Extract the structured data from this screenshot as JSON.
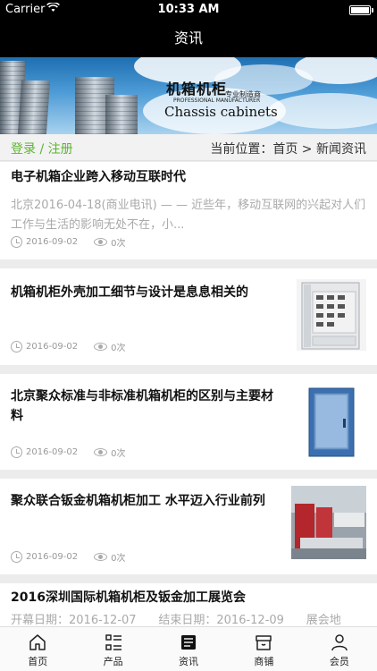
{
  "status_bar": {
    "carrier": "Carrier",
    "time": "10:33 AM"
  },
  "nav": {
    "title": "资讯"
  },
  "banner": {
    "title_cn": "机箱机柜",
    "tagline": "专业制造商",
    "tagline_en": "PROFESSIONAL MANUFACTURER",
    "title_en": "Chassis cabinets"
  },
  "crumb": {
    "login": "登录 / 注册",
    "location": "当前位置：首页 > 新闻资讯"
  },
  "articles": [
    {
      "title": "电子机箱企业跨入移动互联时代",
      "summary": "北京2016-04-18(商业电讯) — — 近些年，移动互联网的兴起对人们工作与生活的影响无处不在，小...",
      "date": "2016-09-02",
      "views": "0次"
    },
    {
      "title": "机箱机柜外壳加工细节与设计是息息相关的",
      "date": "2016-09-02",
      "views": "0次"
    },
    {
      "title": "北京聚众标准与非标准机箱机柜的区别与主要材料",
      "date": "2016-09-02",
      "views": "0次"
    },
    {
      "title": "聚众联合钣金机箱机柜加工 水平迈入行业前列",
      "date": "2016-09-02",
      "views": "0次"
    }
  ],
  "expo": {
    "title": "2016深圳国际机箱机柜及钣金加工展览会",
    "start_label": "开幕日期：",
    "start_date": "2016-12-07",
    "end_label": "结束日期：",
    "end_date": "2016-12-09",
    "venue_label": "展会地"
  },
  "tabbar": {
    "items": [
      {
        "label": "首页",
        "icon": "home-icon"
      },
      {
        "label": "产品",
        "icon": "list-icon"
      },
      {
        "label": "资讯",
        "icon": "news-icon"
      },
      {
        "label": "商铺",
        "icon": "shop-icon"
      },
      {
        "label": "会员",
        "icon": "user-icon"
      }
    ]
  }
}
